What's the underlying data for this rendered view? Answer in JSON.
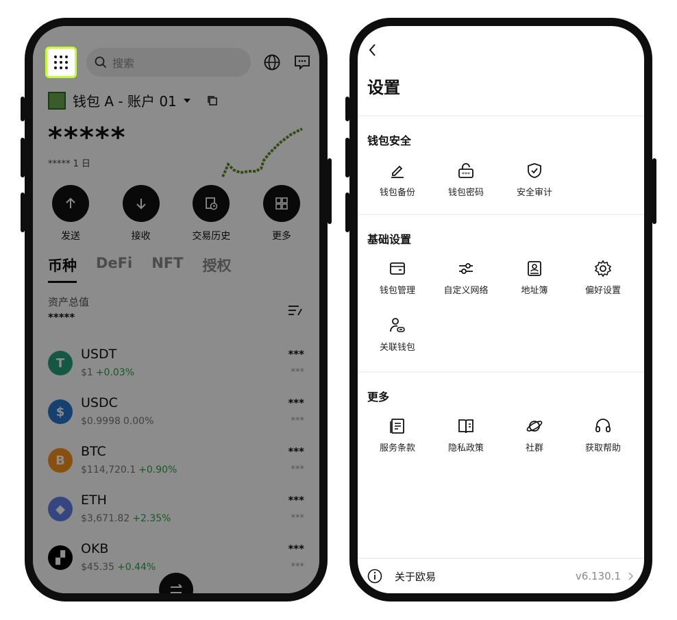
{
  "left": {
    "search_placeholder": "搜索",
    "account_name": "钱包 A - 账户 01",
    "balance": "*****",
    "sub_label": "***** 1 日",
    "actions": [
      {
        "label": "发送",
        "icon": "arrow-up-icon"
      },
      {
        "label": "接收",
        "icon": "arrow-down-icon"
      },
      {
        "label": "交易历史",
        "icon": "history-icon"
      },
      {
        "label": "更多",
        "icon": "more-grid-icon"
      }
    ],
    "tabs": [
      "币种",
      "DeFi",
      "NFT",
      "授权"
    ],
    "total_label": "资产总值",
    "total_value": "*****",
    "assets": [
      {
        "symbol": "USDT",
        "price": "$1",
        "change": "+0.03%",
        "amount": "***",
        "amount2": "***",
        "color": "#26a17b",
        "glyph": "T"
      },
      {
        "symbol": "USDC",
        "price": "$0.9998",
        "change": "0.00%",
        "amount": "***",
        "amount2": "***",
        "color": "#2775ca",
        "glyph": "$"
      },
      {
        "symbol": "BTC",
        "price": "$114,720.1",
        "change": "+0.90%",
        "amount": "***",
        "amount2": "***",
        "color": "#f7931a",
        "glyph": "B"
      },
      {
        "symbol": "ETH",
        "price": "$3,671.82",
        "change": "+2.35%",
        "amount": "***",
        "amount2": "***",
        "color": "#627eea",
        "glyph": "◆"
      },
      {
        "symbol": "OKB",
        "price": "$45.35",
        "change": "+0.44%",
        "amount": "***",
        "amount2": "***",
        "color": "#000000",
        "glyph": "▞"
      }
    ]
  },
  "right": {
    "title": "设置",
    "sections": [
      {
        "title": "钱包安全",
        "items": [
          {
            "label": "钱包备份",
            "icon": "pencil-icon"
          },
          {
            "label": "钱包密码",
            "icon": "lock-password-icon"
          },
          {
            "label": "安全审计",
            "icon": "shield-check-icon"
          }
        ]
      },
      {
        "title": "基础设置",
        "items": [
          {
            "label": "钱包管理",
            "icon": "wallet-icon"
          },
          {
            "label": "自定义网络",
            "icon": "sliders-icon"
          },
          {
            "label": "地址簿",
            "icon": "contact-book-icon"
          },
          {
            "label": "偏好设置",
            "icon": "gear-icon"
          },
          {
            "label": "关联钱包",
            "icon": "link-user-icon"
          }
        ]
      },
      {
        "title": "更多",
        "items": [
          {
            "label": "服务条款",
            "icon": "document-icon"
          },
          {
            "label": "隐私政策",
            "icon": "book-icon"
          },
          {
            "label": "社群",
            "icon": "planet-icon"
          },
          {
            "label": "获取帮助",
            "icon": "headset-icon"
          }
        ]
      }
    ],
    "footer": {
      "label": "关于欧易",
      "version": "v6.130.1"
    }
  },
  "colors": {
    "highlight": "#c4ff2d",
    "positive": "#2fa34a",
    "overlay": "rgba(0,0,0,0.45)"
  }
}
